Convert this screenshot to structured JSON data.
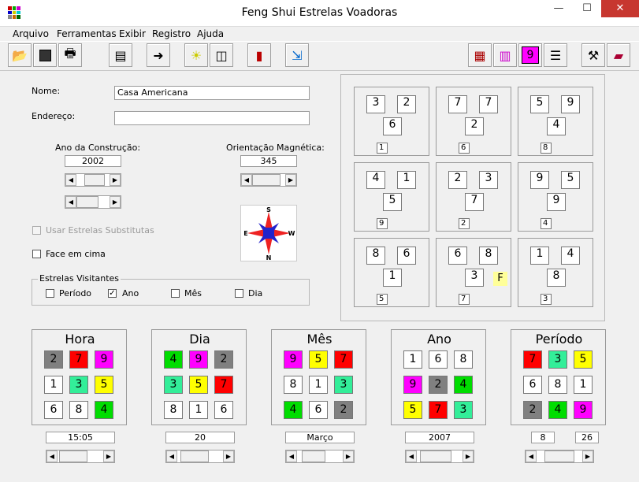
{
  "window": {
    "title": "Feng Shui Estrelas Voadoras",
    "minimize": "—",
    "maximize": "☐",
    "close": "✕"
  },
  "menu": [
    "Arquivo",
    "Ferramentas",
    "Exibir",
    "Registro",
    "Ajuda"
  ],
  "form": {
    "nome_label": "Nome:",
    "nome_value": "Casa Americana",
    "endereco_label": "Endereço:",
    "endereco_value": "",
    "ano_label": "Ano da Construção:",
    "ano_value": "2002",
    "orient_label": "Orientação Magnética:",
    "orient_value": "345",
    "substitutas_label": "Usar Estrelas Substitutas",
    "face_label": "Face em cima",
    "visitantes_title": "Estrelas Visitantes",
    "periodo_label": "Período",
    "ano_chk_label": "Ano",
    "mes_label": "Mês",
    "dia_label": "Dia"
  },
  "compass": {
    "n": "N",
    "s": "S",
    "e": "E",
    "w": "W"
  },
  "chart": [
    {
      "a": "3",
      "b": "2",
      "c": "6",
      "d": "1",
      "f": ""
    },
    {
      "a": "7",
      "b": "7",
      "c": "2",
      "d": "6",
      "f": ""
    },
    {
      "a": "5",
      "b": "9",
      "c": "4",
      "d": "8",
      "f": ""
    },
    {
      "a": "4",
      "b": "1",
      "c": "5",
      "d": "9",
      "f": ""
    },
    {
      "a": "2",
      "b": "3",
      "c": "7",
      "d": "2",
      "f": ""
    },
    {
      "a": "9",
      "b": "5",
      "c": "9",
      "d": "4",
      "f": ""
    },
    {
      "a": "8",
      "b": "6",
      "c": "1",
      "d": "5",
      "f": ""
    },
    {
      "a": "6",
      "b": "8",
      "c": "3",
      "d": "7",
      "f": "F"
    },
    {
      "a": "1",
      "b": "4",
      "c": "8",
      "d": "3",
      "f": ""
    }
  ],
  "periods": [
    {
      "title": "Hora",
      "cells": [
        "2",
        "7",
        "9",
        "1",
        "3",
        "5",
        "6",
        "8",
        "4"
      ],
      "colors": [
        "#808080",
        "#ff0000",
        "#ff00ff",
        "#ffffff",
        "#33ee99",
        "#ffff00",
        "#ffffff",
        "#ffffff",
        "#00dd00"
      ],
      "value": "15:05"
    },
    {
      "title": "Dia",
      "cells": [
        "4",
        "9",
        "2",
        "3",
        "5",
        "7",
        "8",
        "1",
        "6"
      ],
      "colors": [
        "#00dd00",
        "#ff00ff",
        "#808080",
        "#33ee99",
        "#ffff00",
        "#ff0000",
        "#ffffff",
        "#ffffff",
        "#ffffff"
      ],
      "value": "20"
    },
    {
      "title": "Mês",
      "cells": [
        "9",
        "5",
        "7",
        "8",
        "1",
        "3",
        "4",
        "6",
        "2"
      ],
      "colors": [
        "#ff00ff",
        "#ffff00",
        "#ff0000",
        "#ffffff",
        "#ffffff",
        "#33ee99",
        "#00dd00",
        "#ffffff",
        "#808080"
      ],
      "value": "Março"
    },
    {
      "title": "Ano",
      "cells": [
        "1",
        "6",
        "8",
        "9",
        "2",
        "4",
        "5",
        "7",
        "3"
      ],
      "colors": [
        "#ffffff",
        "#ffffff",
        "#ffffff",
        "#ff00ff",
        "#808080",
        "#00dd00",
        "#ffff00",
        "#ff0000",
        "#33ee99"
      ],
      "value": "2007"
    },
    {
      "title": "Período",
      "cells": [
        "7",
        "3",
        "5",
        "6",
        "8",
        "1",
        "2",
        "4",
        "9"
      ],
      "colors": [
        "#ff0000",
        "#33ee99",
        "#ffff00",
        "#ffffff",
        "#ffffff",
        "#ffffff",
        "#808080",
        "#00dd00",
        "#ff00ff"
      ],
      "value": "8",
      "value2": "26"
    }
  ]
}
